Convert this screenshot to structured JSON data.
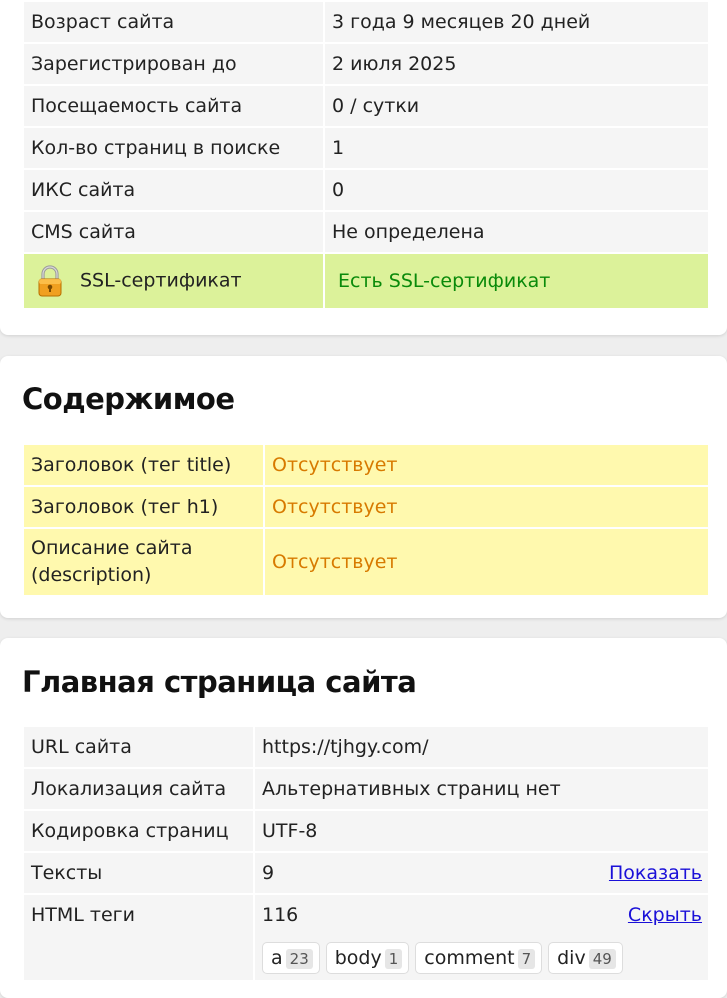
{
  "domain_info": {
    "rows": [
      {
        "label": "Возраст сайта",
        "value": "3 года 9 месяцев 20 дней"
      },
      {
        "label": "Зарегистрирован до",
        "value": "2 июля 2025"
      },
      {
        "label": "Посещаемость сайта",
        "value": "0 / сутки"
      },
      {
        "label": "Кол-во страниц в поиске",
        "value": "1"
      },
      {
        "label": "ИКС сайта",
        "value": "0"
      },
      {
        "label": "CMS сайта",
        "value": "Не определена"
      }
    ],
    "ssl": {
      "label": "SSL-сертификат",
      "value": "Есть SSL-сертификат",
      "icon": "padlock-icon"
    }
  },
  "content": {
    "title": "Содержимое",
    "rows": [
      {
        "label": "Заголовок (тег title)",
        "value": "Отсутствует"
      },
      {
        "label": "Заголовок (тег h1)",
        "value": "Отсутствует"
      },
      {
        "label": "Описание сайта (description)",
        "value": "Отсутствует"
      }
    ]
  },
  "homepage": {
    "title": "Главная страница сайта",
    "rows": [
      {
        "label": "URL сайта",
        "value": "https://tjhgy.com/"
      },
      {
        "label": "Локализация сайта",
        "value": "Альтернативных страниц нет"
      },
      {
        "label": "Кодировка страниц",
        "value": "UTF-8"
      },
      {
        "label": "Тексты",
        "value": "9",
        "link": "Показать"
      },
      {
        "label": "HTML теги",
        "value": "116",
        "link": "Скрыть"
      }
    ],
    "tags": [
      {
        "name": "a",
        "count": "23"
      },
      {
        "name": "body",
        "count": "1"
      },
      {
        "name": "comment",
        "count": "7"
      },
      {
        "name": "div",
        "count": "49"
      }
    ]
  },
  "colors": {
    "ssl_bg": "#dcf29a",
    "warn_bg": "#fff9ae",
    "ok_text": "#0a8a0a",
    "warn_text": "#d77a00",
    "link": "#1a10d8"
  }
}
